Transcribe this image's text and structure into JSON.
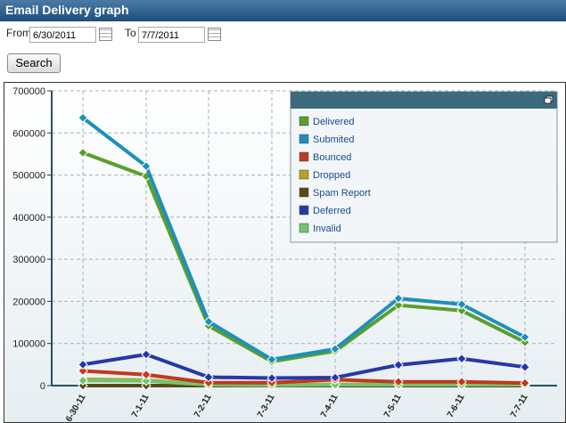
{
  "window": {
    "title": "Email Delivery graph"
  },
  "filter": {
    "from_label": "From",
    "from_value": "6/30/2011",
    "to_label": "To",
    "to_value": "7/7/2011",
    "calendar_icon": "calendar-icon",
    "search_label": "Search"
  },
  "legend": {
    "restore_icon": "restore-window-icon",
    "header_color": "#3e6b7c"
  },
  "chart_data": {
    "type": "line",
    "categories": [
      "6-30-11",
      "7-1-11",
      "7-2-11",
      "7-3-11",
      "7-4-11",
      "7-5-11",
      "7-6-11",
      "7-7-11"
    ],
    "ylim": [
      0,
      700000
    ],
    "yticks": [
      "0",
      "100000",
      "200000",
      "300000",
      "400000",
      "500000",
      "600000",
      "700000"
    ],
    "grid": true,
    "legend_position": "top-right",
    "series": [
      {
        "name": "Delivered",
        "color": "#5a9e2e",
        "values": [
          553000,
          497000,
          142000,
          57000,
          82000,
          191000,
          178000,
          103000
        ]
      },
      {
        "name": "Submited",
        "color": "#1e90b8",
        "values": [
          636000,
          521000,
          152000,
          62000,
          87000,
          207000,
          193000,
          115000
        ]
      },
      {
        "name": "Bounced",
        "color": "#c0391b",
        "values": [
          35000,
          26000,
          7000,
          7000,
          14000,
          9000,
          9000,
          6000
        ]
      },
      {
        "name": "Dropped",
        "color": "#b9a122",
        "values": [
          15000,
          13000,
          3000,
          1000,
          3000,
          3000,
          3000,
          3000
        ]
      },
      {
        "name": "Spam Report",
        "color": "#5a4a12",
        "values": [
          0,
          0,
          0,
          0,
          0,
          0,
          0,
          0
        ]
      },
      {
        "name": "Deferred",
        "color": "#2538a8",
        "values": [
          50000,
          74000,
          20000,
          18000,
          19000,
          49000,
          64000,
          44000
        ]
      },
      {
        "name": "Invalid",
        "color": "#72c472",
        "values": [
          12000,
          11000,
          2000,
          1000,
          2000,
          2000,
          2000,
          2000
        ]
      }
    ]
  }
}
